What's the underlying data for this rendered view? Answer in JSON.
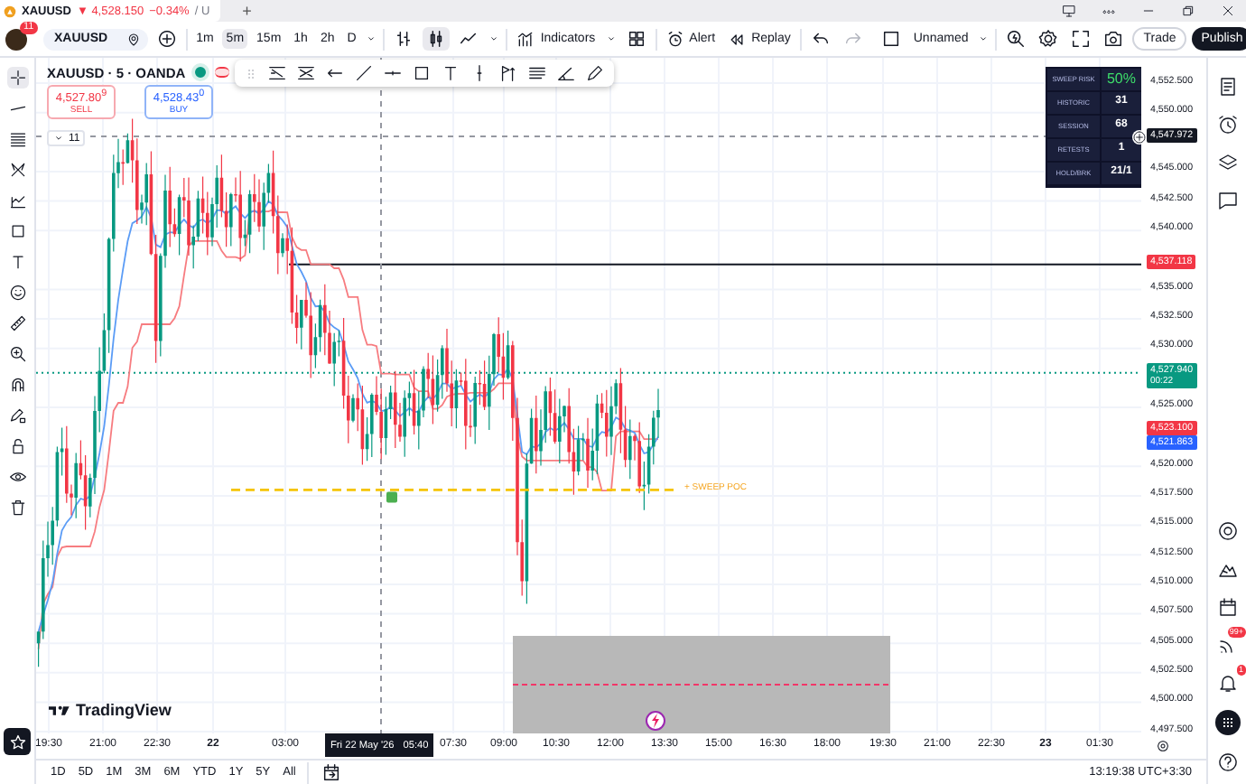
{
  "browser_tab": {
    "symbol": "XAUUSD",
    "quote": "▼ 4,528.150",
    "change": "−0.34%",
    "rest": "/ U",
    "new_tab": "+"
  },
  "toolbar": {
    "avatar_badge": "11",
    "symbol": "XAUUSD",
    "intervals": [
      {
        "label": "1m",
        "selected": false
      },
      {
        "label": "5m",
        "selected": true
      },
      {
        "label": "15m",
        "selected": false
      },
      {
        "label": "1h",
        "selected": false
      },
      {
        "label": "2h",
        "selected": false
      },
      {
        "label": "D",
        "selected": false
      }
    ],
    "indicators": "Indicators",
    "alert": "Alert",
    "replay": "Replay",
    "layout": "Unnamed",
    "trade": "Trade",
    "publish": "Publish"
  },
  "left_tools": [
    {
      "kind": "crosshair",
      "selected": true
    },
    {
      "kind": "line",
      "selected": false
    },
    {
      "kind": "fib",
      "selected": false
    },
    {
      "kind": "pattern",
      "selected": false
    },
    {
      "kind": "forecast",
      "selected": false
    },
    {
      "kind": "rect",
      "selected": false
    },
    {
      "kind": "text",
      "selected": false
    },
    {
      "kind": "smile",
      "selected": false
    },
    {
      "kind": "ruler",
      "selected": false
    },
    {
      "kind": "zoom",
      "selected": false
    },
    {
      "kind": "magnet",
      "selected": false
    },
    {
      "kind": "pencil_lock",
      "selected": false
    },
    {
      "kind": "lock",
      "selected": false
    },
    {
      "kind": "eye",
      "selected": false
    },
    {
      "kind": "trash",
      "selected": false
    }
  ],
  "legend": {
    "title": "XAUUSD · 5 · OANDA",
    "sell_price": "4,527.80$^{9}$",
    "sell_label": "SELL",
    "buy_price": "4,528.43$^{0}$",
    "buy_label": "BUY",
    "collapse": "11"
  },
  "sweep_table": [
    {
      "label": "SWEEP RISK",
      "value": "50%",
      "kind": "risk"
    },
    {
      "label": "HISTORIC",
      "value": "31",
      "kind": "stat"
    },
    {
      "label": "SESSION",
      "value": "68",
      "kind": "stat"
    },
    {
      "label": "RETESTS",
      "value": "1",
      "kind": "stat"
    },
    {
      "label": "HOLD/BRK",
      "value": "21/1",
      "kind": "stat"
    }
  ],
  "sweep_poc_label": "+ SWEEP POC",
  "brand": "TradingView",
  "price_axis": [
    "4,552.500",
    "4,550.000",
    "4,545.000",
    "4,542.500",
    "4,540.000",
    "4,535.000",
    "4,532.500",
    "4,530.000",
    "4,525.000",
    "4,520.000",
    "4,517.500",
    "4,515.000",
    "4,512.500",
    "4,510.000",
    "4,507.500",
    "4,505.000",
    "4,502.500",
    "4,500.000",
    "4,497.500"
  ],
  "price_badges": [
    {
      "price": "4,547.972",
      "kind": "crosshair"
    },
    {
      "price": "4,537.118",
      "kind": "line"
    },
    {
      "price": "4,527.940",
      "countdown": "00:22",
      "kind": "last"
    },
    {
      "price": "4,523.100",
      "kind": "sell"
    },
    {
      "price": "4,521.863",
      "kind": "buy"
    }
  ],
  "time_axis": [
    {
      "label": "19:30",
      "kind": "time"
    },
    {
      "label": "21:00",
      "kind": "time"
    },
    {
      "label": "22:30",
      "kind": "time"
    },
    {
      "label": "22",
      "kind": "day"
    },
    {
      "label": "03:00",
      "kind": "time"
    },
    {
      "label": "07:30",
      "kind": "time"
    },
    {
      "label": "09:00",
      "kind": "time"
    },
    {
      "label": "10:30",
      "kind": "time"
    },
    {
      "label": "12:00",
      "kind": "time"
    },
    {
      "label": "13:30",
      "kind": "time"
    },
    {
      "label": "15:00",
      "kind": "time"
    },
    {
      "label": "16:30",
      "kind": "time"
    },
    {
      "label": "18:00",
      "kind": "time"
    },
    {
      "label": "19:30",
      "kind": "time"
    },
    {
      "label": "21:00",
      "kind": "time"
    },
    {
      "label": "22:30",
      "kind": "time"
    },
    {
      "label": "23",
      "kind": "day"
    },
    {
      "label": "01:30",
      "kind": "time"
    }
  ],
  "cursor_time": {
    "date": "Fri 22 May '26",
    "time": "05:40"
  },
  "ranges": [
    "1D",
    "5D",
    "1M",
    "3M",
    "6M",
    "YTD",
    "1Y",
    "5Y",
    "All"
  ],
  "clock": "13:19:38 UTC+3:30",
  "right_tools": [
    {
      "kind": "list"
    },
    {
      "kind": "alarm"
    },
    {
      "kind": "layers"
    },
    {
      "kind": "chat"
    },
    {
      "kind": "target"
    },
    {
      "kind": "mountain"
    },
    {
      "kind": "calendar"
    },
    {
      "kind": "feed",
      "badge": "99+"
    },
    {
      "kind": "bell",
      "badge": "1"
    },
    {
      "kind": "apps"
    },
    {
      "kind": "help"
    }
  ]
}
